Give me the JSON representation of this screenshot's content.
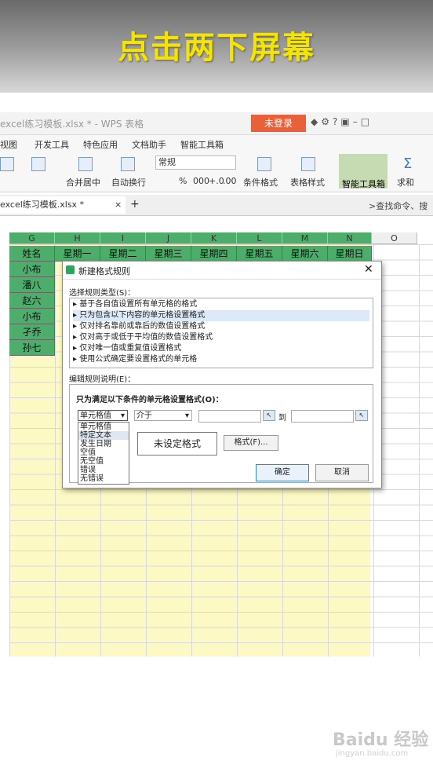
{
  "banner": {
    "text": "点击两下屏幕"
  },
  "window": {
    "title": "excel练习模板.xlsx * - WPS 表格",
    "login": "未登录"
  },
  "menu": [
    "视图",
    "开发工具",
    "特色应用",
    "文档助手",
    "智能工具箱"
  ],
  "ribbon": {
    "merge": "合并居中",
    "wrap": "自动换行",
    "number_format": "常规",
    "cond_format": "条件格式",
    "table_style": "表格样式",
    "smart_tools": "智能工具箱",
    "sum": "求和",
    "percent": "%",
    "comma": "000",
    "inc_dec": "+.0",
    "dec_dec": ".00"
  },
  "tabs": {
    "file": "excel练习模板.xlsx *",
    "search": ">查找命令、搜"
  },
  "sheet": {
    "columns": [
      "G",
      "H",
      "I",
      "J",
      "K",
      "L",
      "M",
      "N",
      "O"
    ],
    "header_row": [
      "姓名",
      "星期一",
      "星期二",
      "星期三",
      "星期四",
      "星期五",
      "星期六",
      "星期日"
    ],
    "names": [
      "小布",
      "潘八",
      "赵六",
      "小布",
      "孑乔",
      "孙七"
    ]
  },
  "dialog": {
    "title": "新建格式规则",
    "section1": "选择规则类型(S)：",
    "rules": [
      "基于各自值设置所有单元格的格式",
      "只为包含以下内容的单元格设置格式",
      "仅对排名靠前或靠后的数值设置格式",
      "仅对高于或低于平均值的数值设置格式",
      "仅对唯一值或重复值设置格式",
      "使用公式确定要设置格式的单元格"
    ],
    "section2": "编辑规则说明(E)：",
    "desc_head": "只为满足以下条件的单元格设置格式(O)：",
    "cond_type": "单元格值",
    "operator": "介于",
    "to": "到",
    "dropdown_options": [
      "单元格值",
      "特定文本",
      "发生日期",
      "空值",
      "无空值",
      "错误",
      "无错误"
    ],
    "preview": "未设定格式",
    "format_btn": "格式(F)...",
    "ok": "确定",
    "cancel": "取消"
  },
  "watermark": {
    "brand": "Baidu 经验",
    "url": "jingyan.baidu.com"
  }
}
